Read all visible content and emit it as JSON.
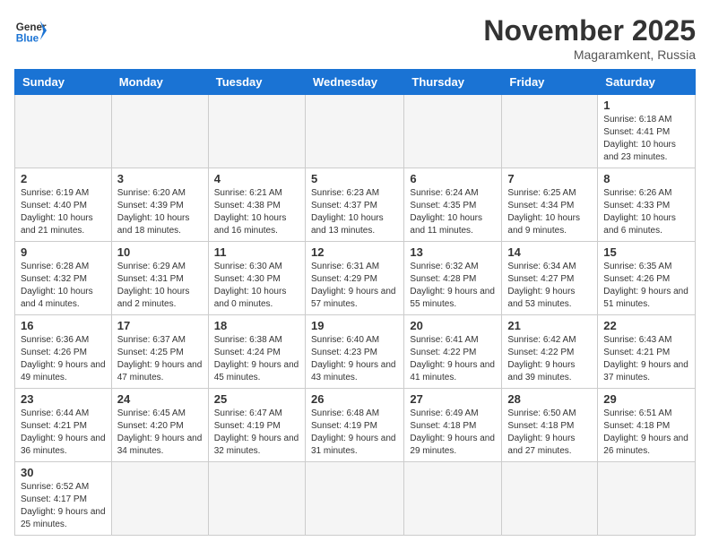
{
  "header": {
    "logo_general": "General",
    "logo_blue": "Blue",
    "month_title": "November 2025",
    "location": "Magaramkent, Russia"
  },
  "weekdays": [
    "Sunday",
    "Monday",
    "Tuesday",
    "Wednesday",
    "Thursday",
    "Friday",
    "Saturday"
  ],
  "weeks": [
    [
      {
        "day": "",
        "info": ""
      },
      {
        "day": "",
        "info": ""
      },
      {
        "day": "",
        "info": ""
      },
      {
        "day": "",
        "info": ""
      },
      {
        "day": "",
        "info": ""
      },
      {
        "day": "",
        "info": ""
      },
      {
        "day": "1",
        "info": "Sunrise: 6:18 AM\nSunset: 4:41 PM\nDaylight: 10 hours and 23 minutes."
      }
    ],
    [
      {
        "day": "2",
        "info": "Sunrise: 6:19 AM\nSunset: 4:40 PM\nDaylight: 10 hours and 21 minutes."
      },
      {
        "day": "3",
        "info": "Sunrise: 6:20 AM\nSunset: 4:39 PM\nDaylight: 10 hours and 18 minutes."
      },
      {
        "day": "4",
        "info": "Sunrise: 6:21 AM\nSunset: 4:38 PM\nDaylight: 10 hours and 16 minutes."
      },
      {
        "day": "5",
        "info": "Sunrise: 6:23 AM\nSunset: 4:37 PM\nDaylight: 10 hours and 13 minutes."
      },
      {
        "day": "6",
        "info": "Sunrise: 6:24 AM\nSunset: 4:35 PM\nDaylight: 10 hours and 11 minutes."
      },
      {
        "day": "7",
        "info": "Sunrise: 6:25 AM\nSunset: 4:34 PM\nDaylight: 10 hours and 9 minutes."
      },
      {
        "day": "8",
        "info": "Sunrise: 6:26 AM\nSunset: 4:33 PM\nDaylight: 10 hours and 6 minutes."
      }
    ],
    [
      {
        "day": "9",
        "info": "Sunrise: 6:28 AM\nSunset: 4:32 PM\nDaylight: 10 hours and 4 minutes."
      },
      {
        "day": "10",
        "info": "Sunrise: 6:29 AM\nSunset: 4:31 PM\nDaylight: 10 hours and 2 minutes."
      },
      {
        "day": "11",
        "info": "Sunrise: 6:30 AM\nSunset: 4:30 PM\nDaylight: 10 hours and 0 minutes."
      },
      {
        "day": "12",
        "info": "Sunrise: 6:31 AM\nSunset: 4:29 PM\nDaylight: 9 hours and 57 minutes."
      },
      {
        "day": "13",
        "info": "Sunrise: 6:32 AM\nSunset: 4:28 PM\nDaylight: 9 hours and 55 minutes."
      },
      {
        "day": "14",
        "info": "Sunrise: 6:34 AM\nSunset: 4:27 PM\nDaylight: 9 hours and 53 minutes."
      },
      {
        "day": "15",
        "info": "Sunrise: 6:35 AM\nSunset: 4:26 PM\nDaylight: 9 hours and 51 minutes."
      }
    ],
    [
      {
        "day": "16",
        "info": "Sunrise: 6:36 AM\nSunset: 4:26 PM\nDaylight: 9 hours and 49 minutes."
      },
      {
        "day": "17",
        "info": "Sunrise: 6:37 AM\nSunset: 4:25 PM\nDaylight: 9 hours and 47 minutes."
      },
      {
        "day": "18",
        "info": "Sunrise: 6:38 AM\nSunset: 4:24 PM\nDaylight: 9 hours and 45 minutes."
      },
      {
        "day": "19",
        "info": "Sunrise: 6:40 AM\nSunset: 4:23 PM\nDaylight: 9 hours and 43 minutes."
      },
      {
        "day": "20",
        "info": "Sunrise: 6:41 AM\nSunset: 4:22 PM\nDaylight: 9 hours and 41 minutes."
      },
      {
        "day": "21",
        "info": "Sunrise: 6:42 AM\nSunset: 4:22 PM\nDaylight: 9 hours and 39 minutes."
      },
      {
        "day": "22",
        "info": "Sunrise: 6:43 AM\nSunset: 4:21 PM\nDaylight: 9 hours and 37 minutes."
      }
    ],
    [
      {
        "day": "23",
        "info": "Sunrise: 6:44 AM\nSunset: 4:21 PM\nDaylight: 9 hours and 36 minutes."
      },
      {
        "day": "24",
        "info": "Sunrise: 6:45 AM\nSunset: 4:20 PM\nDaylight: 9 hours and 34 minutes."
      },
      {
        "day": "25",
        "info": "Sunrise: 6:47 AM\nSunset: 4:19 PM\nDaylight: 9 hours and 32 minutes."
      },
      {
        "day": "26",
        "info": "Sunrise: 6:48 AM\nSunset: 4:19 PM\nDaylight: 9 hours and 31 minutes."
      },
      {
        "day": "27",
        "info": "Sunrise: 6:49 AM\nSunset: 4:18 PM\nDaylight: 9 hours and 29 minutes."
      },
      {
        "day": "28",
        "info": "Sunrise: 6:50 AM\nSunset: 4:18 PM\nDaylight: 9 hours and 27 minutes."
      },
      {
        "day": "29",
        "info": "Sunrise: 6:51 AM\nSunset: 4:18 PM\nDaylight: 9 hours and 26 minutes."
      }
    ],
    [
      {
        "day": "30",
        "info": "Sunrise: 6:52 AM\nSunset: 4:17 PM\nDaylight: 9 hours and 25 minutes."
      },
      {
        "day": "",
        "info": ""
      },
      {
        "day": "",
        "info": ""
      },
      {
        "day": "",
        "info": ""
      },
      {
        "day": "",
        "info": ""
      },
      {
        "day": "",
        "info": ""
      },
      {
        "day": "",
        "info": ""
      }
    ]
  ]
}
